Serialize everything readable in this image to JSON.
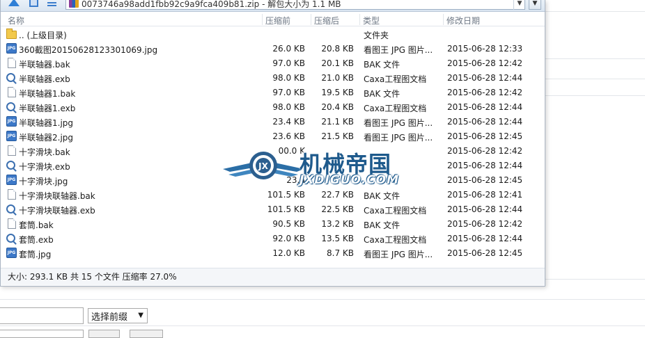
{
  "window": {
    "path_text": "0073746a98add1fbb92c9a9fca409b81.zip - 解包大小为 1.1 MB"
  },
  "columns": {
    "name": "名称",
    "size": "压缩前",
    "packed": "压缩后",
    "type": "类型",
    "modified": "修改日期"
  },
  "files": [
    {
      "icon": "folder-icon",
      "name": ".. (上级目录)",
      "size": "",
      "packed": "",
      "type": "文件夹",
      "modified": ""
    },
    {
      "icon": "jpg-file-icon",
      "name": "360截图20150628123301069.jpg",
      "size": "26.0 KB",
      "packed": "20.8 KB",
      "type": "看图王 JPG 图片...",
      "modified": "2015-06-28 12:33"
    },
    {
      "icon": "bak-file-icon",
      "name": "半联轴器.bak",
      "size": "97.0 KB",
      "packed": "20.1 KB",
      "type": "BAK 文件",
      "modified": "2015-06-28 12:42"
    },
    {
      "icon": "exb-file-icon",
      "name": "半联轴器.exb",
      "size": "98.0 KB",
      "packed": "21.0 KB",
      "type": "Caxa工程图文档",
      "modified": "2015-06-28 12:44"
    },
    {
      "icon": "bak-file-icon",
      "name": "半联轴器1.bak",
      "size": "97.0 KB",
      "packed": "19.5 KB",
      "type": "BAK 文件",
      "modified": "2015-06-28 12:42"
    },
    {
      "icon": "exb-file-icon",
      "name": "半联轴器1.exb",
      "size": "98.0 KB",
      "packed": "20.4 KB",
      "type": "Caxa工程图文档",
      "modified": "2015-06-28 12:44"
    },
    {
      "icon": "jpg-file-icon",
      "name": "半联轴器1.jpg",
      "size": "23.4 KB",
      "packed": "21.1 KB",
      "type": "看图王 JPG 图片...",
      "modified": "2015-06-28 12:44"
    },
    {
      "icon": "jpg-file-icon",
      "name": "半联轴器2.jpg",
      "size": "23.6 KB",
      "packed": "21.5 KB",
      "type": "看图王 JPG 图片...",
      "modified": "2015-06-28 12:45"
    },
    {
      "icon": "bak-file-icon",
      "name": "十字滑块.bak",
      "size": "00.0 K",
      "packed": "",
      "type": "",
      "modified": "2015-06-28 12:42"
    },
    {
      "icon": "exb-file-icon",
      "name": "十字滑块.exb",
      "size": "",
      "packed": "",
      "type": "",
      "modified": "2015-06-28 12:44"
    },
    {
      "icon": "jpg-file-icon",
      "name": "十字滑块.jpg",
      "size": "23.5",
      "packed": "",
      "type": "",
      "modified": "2015-06-28 12:45"
    },
    {
      "icon": "bak-file-icon",
      "name": "十字滑块联轴器.bak",
      "size": "101.5 KB",
      "packed": "22.7 KB",
      "type": "BAK 文件",
      "modified": "2015-06-28 12:41"
    },
    {
      "icon": "exb-file-icon",
      "name": "十字滑块联轴器.exb",
      "size": "101.5 KB",
      "packed": "22.5 KB",
      "type": "Caxa工程图文档",
      "modified": "2015-06-28 12:44"
    },
    {
      "icon": "bak-file-icon",
      "name": "套筒.bak",
      "size": "90.5 KB",
      "packed": "13.2 KB",
      "type": "BAK 文件",
      "modified": "2015-06-28 12:42"
    },
    {
      "icon": "exb-file-icon",
      "name": "套筒.exb",
      "size": "92.0 KB",
      "packed": "13.5 KB",
      "type": "Caxa工程图文档",
      "modified": "2015-06-28 12:44"
    },
    {
      "icon": "jpg-file-icon",
      "name": "套筒.jpg",
      "size": "12.0 KB",
      "packed": "8.7 KB",
      "type": "看图王 JPG 图片...",
      "modified": "2015-06-28 12:45"
    }
  ],
  "status_text": "大小: 293.1 KB 共 15 个文件 压缩率 27.0%",
  "watermark": {
    "title": "机械帝国",
    "url": "JXDIGUO.COM"
  },
  "form": {
    "prefix_select_value": "选择前缀"
  }
}
